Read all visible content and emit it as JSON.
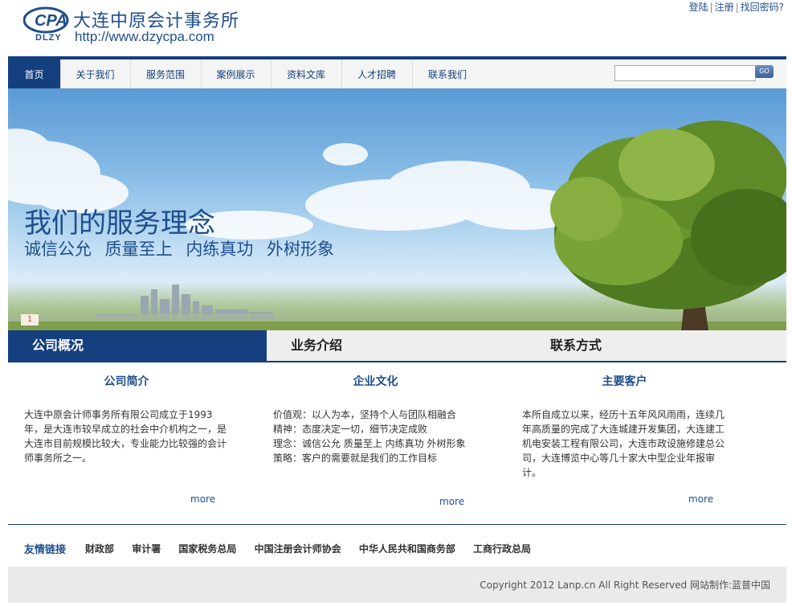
{
  "logo": {
    "cn_name": "大连中原会计事务所",
    "url": "http://www.dzycpa.com",
    "mark_text": "CPA",
    "mark_sub": "DLZY"
  },
  "top_links": {
    "login": "登陆",
    "register": "注册",
    "forgot": "找回密码?",
    "sep": "|"
  },
  "nav": {
    "items": [
      "首页",
      "关于我们",
      "服务范围",
      "案例展示",
      "资料文库",
      "人才招聘",
      "联系我们"
    ],
    "active_index": 0
  },
  "search": {
    "value": "",
    "button": "GO"
  },
  "banner": {
    "title": "我们的服务理念",
    "subtitle": "诚信公允 质量至上 内练真功 外树形象",
    "slide_index": "1"
  },
  "tabs": {
    "items": [
      "公司概况",
      "业务介绍",
      "联系方式"
    ],
    "active_index": 0
  },
  "columns": [
    {
      "title": "公司简介",
      "lines": [
        "大连中原会计师事务所有限公司成立于1993",
        "年，是大连市较早成立的社会中介机构之一，是",
        "大连市目前规模比较大，专业能力比较强的会计",
        "师事务所之一。"
      ],
      "more": "more"
    },
    {
      "title": "企业文化",
      "lines": [
        "价值观：以人为本，坚持个人与团队相融合",
        "精神：态度决定一切，细节决定成败",
        "理念：诚信公允 质量至上 内练真功 外树形象",
        "策略：客户的需要就是我们的工作目标"
      ],
      "more": "more"
    },
    {
      "title": "主要客户",
      "lines": [
        "本所自成立以来，经历十五年风风雨雨，连续几",
        "年高质量的完成了大连城建开发集团，大连建工",
        "机电安装工程有限公司，大连市政设施修建总公",
        "司，大连博览中心等几十家大中型企业年报审",
        "计。"
      ],
      "more": "more"
    }
  ],
  "friend_links": {
    "label": "友情链接",
    "items": [
      "财政部",
      "审计署",
      "国家税务总局",
      "中国注册会计师协会",
      "中华人民共和国商务部",
      "工商行政总局"
    ]
  },
  "footer": {
    "copyright": "Copyright 2012 Lanp.cn All Right Reserved 网站制作:蓝普中国"
  },
  "colors": {
    "brand": "#14407f",
    "accent_text": "#1f4e8c"
  }
}
